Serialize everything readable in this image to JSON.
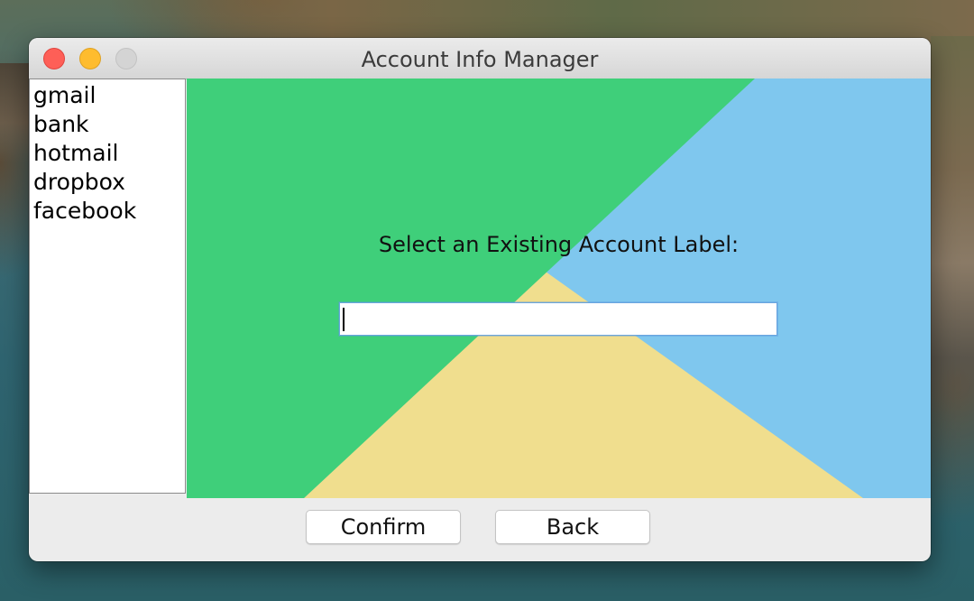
{
  "window": {
    "title": "Account Info Manager"
  },
  "accounts": {
    "items": [
      "gmail",
      "bank",
      "hotmail",
      "dropbox",
      "facebook"
    ]
  },
  "form": {
    "prompt": "Select an Existing Account Label:",
    "label_value": ""
  },
  "buttons": {
    "confirm_label": "Confirm",
    "back_label": "Back"
  },
  "colors": {
    "background_green": "#3fcf7a",
    "background_blue": "#7fc7ee",
    "background_yellow": "#f0de8e",
    "close_light": "#fe5f57",
    "minimize_light": "#febc2e",
    "zoom_light": "#d4d4d4"
  }
}
